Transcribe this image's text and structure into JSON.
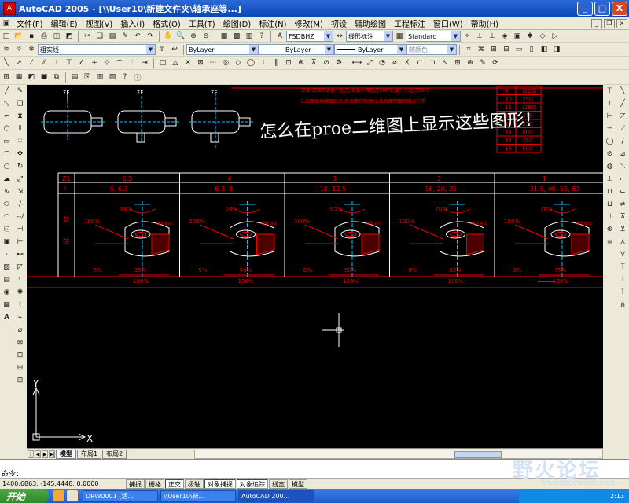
{
  "titlebar": {
    "title": "AutoCAD 2005 - [\\\\User10\\新建文件夹\\轴承座等...]",
    "btn_min": "_",
    "btn_max": "□",
    "btn_close": "X"
  },
  "menu": {
    "items": [
      "文件(F)",
      "编辑(E)",
      "视图(V)",
      "插入(I)",
      "格式(O)",
      "工具(T)",
      "绘图(D)",
      "标注(N)",
      "修改(M)",
      "初设",
      "辅助绘图",
      "工程标注",
      "窗口(W)",
      "帮助(H)"
    ]
  },
  "toolbar2": {
    "text_style": "FSDBHZ",
    "dim_style": "线形标注",
    "table_style": "Standard"
  },
  "toolbar3": {
    "layer": "粗实线",
    "color": "ByLayer",
    "linetype": "ByLayer",
    "lineweight": "ByLayer",
    "plotstyle": "随颜色"
  },
  "drawing": {
    "overlay_text": "怎么在proe二维图上显示这些图形！",
    "red_note_1": "试验,试验应油量不超过,油温不得超过100℃,温升不超过50℃",
    "red_note_2": "5.齿面啮合接触斑点:齿合面积检验时,齿合面积接触斑点分布",
    "right_table_rows": [
      [
        "9",
        "(225)"
      ],
      [
        "10",
        "250"
      ],
      [
        "11",
        "(280)"
      ],
      [
        "12",
        "315"
      ],
      [
        "13",
        "355"
      ],
      [
        "14",
        "400"
      ],
      [
        "15",
        "450"
      ],
      [
        "16",
        "500"
      ]
    ],
    "header_z": "Z1",
    "header_i": "i",
    "grades": [
      "6.5",
      "4",
      "3",
      "2",
      "1"
    ],
    "ratios": [
      "5, 6.3",
      "6.3, 8",
      "10, 12.5",
      "16, 20, 25",
      "31.5, 40, 50, 63"
    ],
    "row_labels": [
      "载",
      "荷"
    ],
    "top_pcts": [
      "60%",
      "60%",
      "65%",
      "70%",
      "70%"
    ],
    "left_pcts": [
      "100%",
      "100%",
      "100%",
      "100%",
      "100%"
    ],
    "bottom_left_pcts": [
      "~5%",
      "~5%",
      "~6%",
      "~8%",
      "~8%"
    ],
    "bottom_mid_pcts": [
      "35%",
      "40%",
      "50%",
      "65%",
      "75%"
    ],
    "bottom_full": [
      "100%",
      "100%",
      "100%",
      "100%",
      "100%"
    ],
    "rot_label": "蜗轮转向",
    "views_label": "ΣF",
    "ucs_x": "X",
    "ucs_y": "Y"
  },
  "layout_tabs": [
    "模型",
    "布局1",
    "布局2"
  ],
  "command": {
    "line1": "",
    "line2": "命令："
  },
  "status": {
    "coords": "1400.6863, -145.4448, 0.0000",
    "buttons": [
      "捕捉",
      "栅格",
      "正交",
      "极轴",
      "对象捕捉",
      "对象追踪",
      "线宽",
      "模型"
    ]
  },
  "taskbar": {
    "start": "开始",
    "tasks": [
      "DRW0001 (活...",
      "\\\\User10\\新...",
      "AutoCAD 200..."
    ],
    "clock": "2:13"
  },
  "watermark": {
    "text": "野火论坛",
    "site": "www.proewildfire.cn"
  },
  "colors": {
    "accent": "#0a44b8",
    "canvas": "#000000",
    "red": "#e00000",
    "cyan": "#00c8ff"
  }
}
